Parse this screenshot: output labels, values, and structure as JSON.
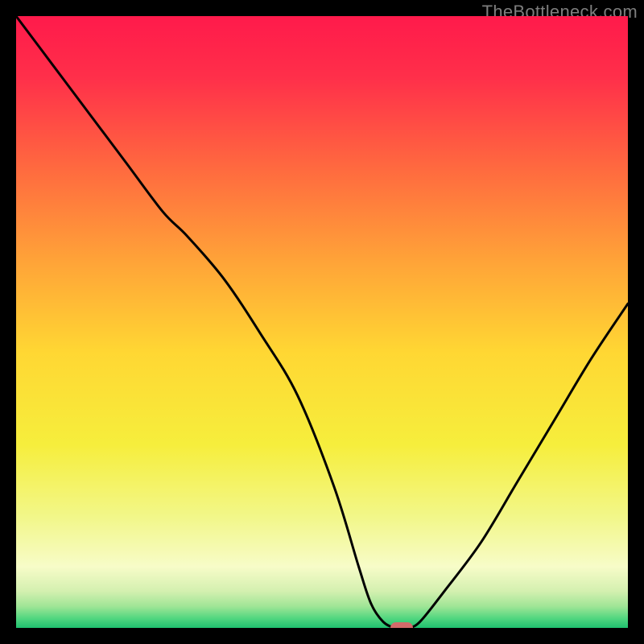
{
  "watermark": "TheBottleneck.com",
  "chart_data": {
    "type": "line",
    "title": "",
    "xlabel": "",
    "ylabel": "",
    "xlim": [
      0,
      100
    ],
    "ylim": [
      0,
      100
    ],
    "grid": false,
    "legend": false,
    "series": [
      {
        "name": "bottleneck-curve",
        "x": [
          0,
          6,
          12,
          18,
          24,
          28,
          34,
          40,
          46,
          52,
          56,
          58,
          60,
          62,
          64,
          66,
          70,
          76,
          82,
          88,
          94,
          100
        ],
        "y": [
          100,
          92,
          84,
          76,
          68,
          64,
          57,
          48,
          38,
          23,
          10,
          4,
          1,
          0,
          0,
          1,
          6,
          14,
          24,
          34,
          44,
          53
        ]
      }
    ],
    "marker": {
      "x": 63,
      "y": 0,
      "color": "#d36a6a"
    },
    "gradient_stops": [
      {
        "offset": 0,
        "color": "#ff1a4b"
      },
      {
        "offset": 0.1,
        "color": "#ff2f4a"
      },
      {
        "offset": 0.25,
        "color": "#ff6a3f"
      },
      {
        "offset": 0.4,
        "color": "#ffa338"
      },
      {
        "offset": 0.55,
        "color": "#ffd733"
      },
      {
        "offset": 0.7,
        "color": "#f6ee3c"
      },
      {
        "offset": 0.82,
        "color": "#f2f78a"
      },
      {
        "offset": 0.9,
        "color": "#f7fcc8"
      },
      {
        "offset": 0.94,
        "color": "#d4f0b0"
      },
      {
        "offset": 0.965,
        "color": "#9fe596"
      },
      {
        "offset": 0.985,
        "color": "#4fd67f"
      },
      {
        "offset": 1.0,
        "color": "#1fc06f"
      }
    ]
  }
}
